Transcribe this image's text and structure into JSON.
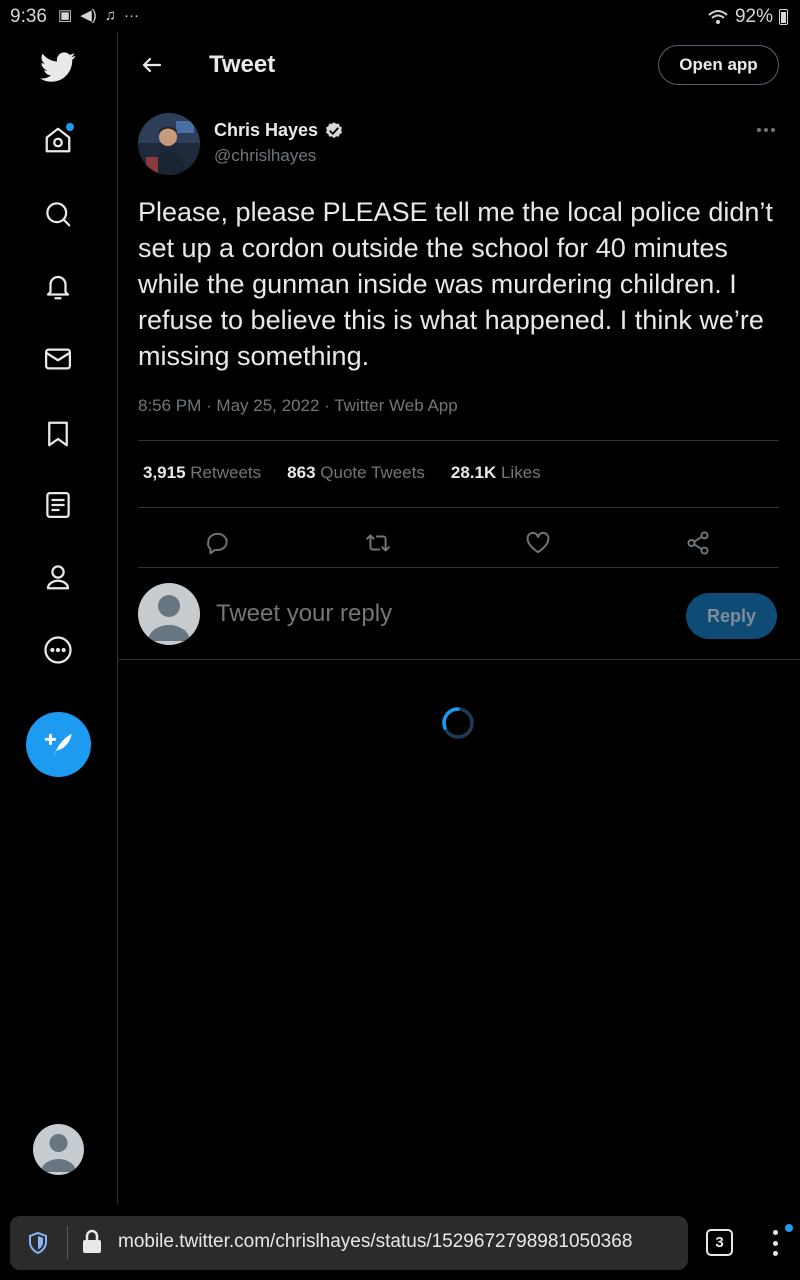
{
  "status_bar": {
    "time": "9:36",
    "battery": "92%"
  },
  "header": {
    "title": "Tweet",
    "open_app_label": "Open app"
  },
  "tweet": {
    "author_name": "Chris Hayes",
    "author_handle": "@chrislhayes",
    "text": "Please, please PLEASE tell me the local police didn’t set up a cordon outside the school for 40 minutes while the gunman inside was murdering children. I refuse to believe this is what happened. I think we’re missing something.",
    "timestamp": "8:56 PM · May 25, 2022 · Twitter Web App",
    "stats": [
      {
        "count": "3,915",
        "label": "Retweets"
      },
      {
        "count": "863",
        "label": "Quote Tweets"
      },
      {
        "count": "28.1K",
        "label": "Likes"
      }
    ]
  },
  "reply": {
    "placeholder": "Tweet your reply",
    "button_label": "Reply"
  },
  "browser": {
    "url": "mobile.twitter.com/chrislhayes/status/1529672798981050368",
    "tab_count": "3"
  },
  "colors": {
    "accent": "#1d9bf0",
    "reply_button": "#0e4c75",
    "background": "#000000",
    "muted_text": "#71767b"
  },
  "icons": {
    "sidebar": [
      "twitter-logo-icon",
      "home-icon",
      "search-icon",
      "bell-icon",
      "mail-icon",
      "bookmark-icon",
      "list-icon",
      "profile-icon",
      "more-circle-icon",
      "compose-icon"
    ],
    "actions": [
      "reply-icon",
      "retweet-icon",
      "like-icon",
      "share-icon"
    ]
  }
}
